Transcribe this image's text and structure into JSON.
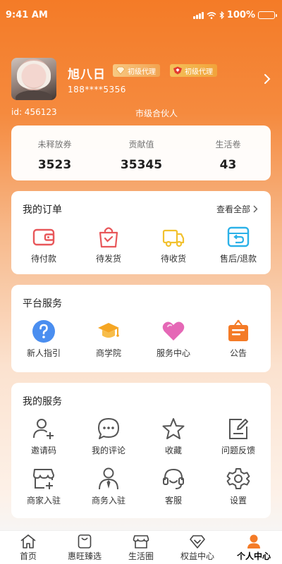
{
  "status_bar": {
    "time": "9:41 AM",
    "battery": "100%"
  },
  "profile": {
    "name": "旭八日",
    "badge_1": "初级代理",
    "badge_2": "初级代理",
    "phone": "188****5356",
    "id": "id: 456123",
    "role": "市级合伙人"
  },
  "stats": [
    {
      "label": "未释放券",
      "value": "3523"
    },
    {
      "label": "贡献值",
      "value": "35345"
    },
    {
      "label": "生活卷",
      "value": "43"
    }
  ],
  "orders": {
    "title": "我的订单",
    "view_all": "查看全部",
    "items": [
      {
        "label": "待付款",
        "icon": "wallet-icon"
      },
      {
        "label": "待发货",
        "icon": "shopping-bag-icon"
      },
      {
        "label": "待收货",
        "icon": "delivery-truck-icon"
      },
      {
        "label": "售后/退款",
        "icon": "refund-icon"
      }
    ]
  },
  "platform": {
    "title": "平台服务",
    "items": [
      {
        "label": "新人指引",
        "icon": "question-icon"
      },
      {
        "label": "商学院",
        "icon": "graduation-cap-icon"
      },
      {
        "label": "服务中心",
        "icon": "heart-icon"
      },
      {
        "label": "公告",
        "icon": "announcement-board-icon"
      }
    ]
  },
  "services": {
    "title": "我的服务",
    "items": [
      {
        "label": "邀请码",
        "icon": "add-user-icon"
      },
      {
        "label": "我的评论",
        "icon": "comment-icon"
      },
      {
        "label": "收藏",
        "icon": "star-icon"
      },
      {
        "label": "问题反馈",
        "icon": "feedback-icon"
      },
      {
        "label": "商家入驻",
        "icon": "store-add-icon"
      },
      {
        "label": "商务入驻",
        "icon": "business-person-icon"
      },
      {
        "label": "客服",
        "icon": "headset-icon"
      },
      {
        "label": "设置",
        "icon": "settings-gear-icon"
      }
    ]
  },
  "tabbar": [
    {
      "label": "首页",
      "icon": "home-icon"
    },
    {
      "label": "惠旺臻选",
      "icon": "shopping-bag-icon"
    },
    {
      "label": "生活圈",
      "icon": "store-icon"
    },
    {
      "label": "权益中心",
      "icon": "diamond-icon"
    },
    {
      "label": "个人中心",
      "icon": "person-icon",
      "active": true
    }
  ],
  "colors": {
    "accent": "#f47b27",
    "icon_red": "#e8575a",
    "icon_yellow": "#f2c12e",
    "icon_blue": "#2bb1e8",
    "icon_pink": "#e568b6"
  }
}
